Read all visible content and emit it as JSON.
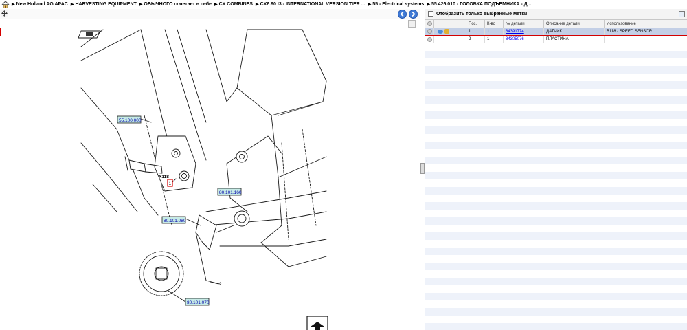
{
  "breadcrumb": {
    "items": [
      "New Holland AG APAC",
      "HARVESTING EQUIPMENT",
      "ОБЫЧНОГО сочетает в себе",
      "CX COMBINES",
      "CX6.90 I3 - INTERNATIONAL VERSION TIER ...",
      "55 - Electrical systems",
      "55.426.010 - ГОЛОВКА ПОДЪЕМНИКА - Д..."
    ],
    "separator": "▶"
  },
  "diagram": {
    "callouts": {
      "c1": "55.100.000",
      "c2": "80.101.160",
      "c3": "80.101.080",
      "c4": "80.101.070"
    },
    "labels": {
      "sensor_code": "X118",
      "pos_1": "1",
      "pos_2": "2"
    }
  },
  "filter": {
    "label": "Отобразить только выбранные метки"
  },
  "table": {
    "headers": [
      "",
      "",
      "Поз.",
      "К-во",
      "№ детали",
      "Описание детали",
      "Использование"
    ],
    "rows": [
      {
        "pos": "1",
        "qty": "1",
        "part_no": "84391774",
        "description": "ДАТЧИК",
        "usage": "B118 - SPEED SENSOR",
        "selected": true
      },
      {
        "pos": "2",
        "qty": "1",
        "part_no": "84305076",
        "description": "ПЛАСТИНА",
        "usage": "",
        "selected": false
      }
    ]
  },
  "colors": {
    "selection_border": "#d40000",
    "selection_bg": "#c3cfe6",
    "nav_button": "#3f7ad6",
    "callout_bg": "#c6ebe6"
  }
}
